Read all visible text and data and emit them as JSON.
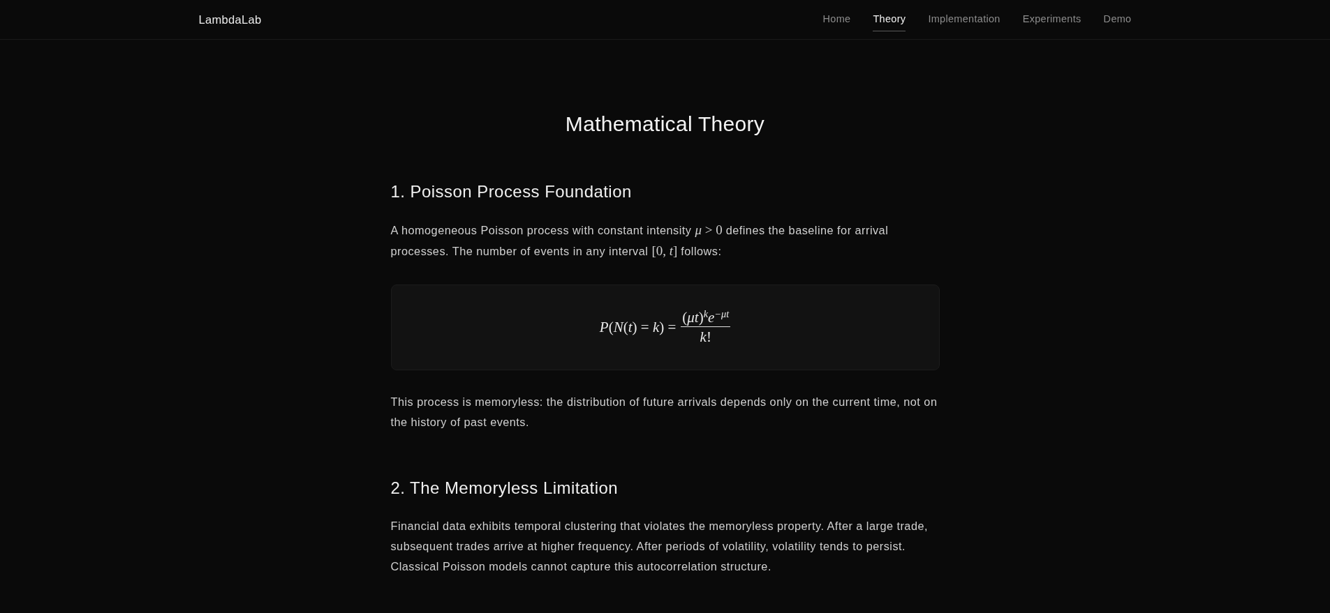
{
  "navbar": {
    "brand": "LambdaLab",
    "links": [
      {
        "label": "Home",
        "selected": false
      },
      {
        "label": "Theory",
        "selected": true
      },
      {
        "label": "Implementation",
        "selected": false
      },
      {
        "label": "Experiments",
        "selected": false
      },
      {
        "label": "Demo",
        "selected": false
      }
    ]
  },
  "page_title": "Mathematical Theory",
  "sections": [
    {
      "heading": "1. Poisson Process Foundation",
      "blocks": [
        {
          "kind": "paragraph",
          "parts": [
            {
              "kind": "text",
              "text": "A homogeneous Poisson process with constant intensity "
            },
            {
              "kind": "math",
              "text": "*μ* > 0"
            },
            {
              "kind": "text",
              "text": " defines the baseline for arrival processes. The number of events in any interval "
            },
            {
              "kind": "math",
              "text": "[0, *t*]"
            },
            {
              "kind": "text",
              "text": " follows:"
            }
          ]
        },
        {
          "kind": "equation",
          "lhs": "*P*(*N*(*t*) = *k*) =",
          "numerator": "(*μt*)$^{k}$*e*$^{−μt}$",
          "denominator": "*k*!"
        },
        {
          "kind": "paragraph",
          "parts": [
            {
              "kind": "text",
              "text": "This process is memoryless: the distribution of future arrivals depends only on the current time, not on the history of past events."
            }
          ]
        }
      ]
    },
    {
      "heading": "2. The Memoryless Limitation",
      "blocks": [
        {
          "kind": "paragraph",
          "parts": [
            {
              "kind": "text",
              "text": "Financial data exhibits temporal clustering that violates the memoryless property. After a large trade, subsequent trades arrive at higher frequency. After periods of volatility, volatility tends to persist. Classical Poisson models cannot capture this autocorrelation structure."
            }
          ]
        }
      ]
    }
  ]
}
